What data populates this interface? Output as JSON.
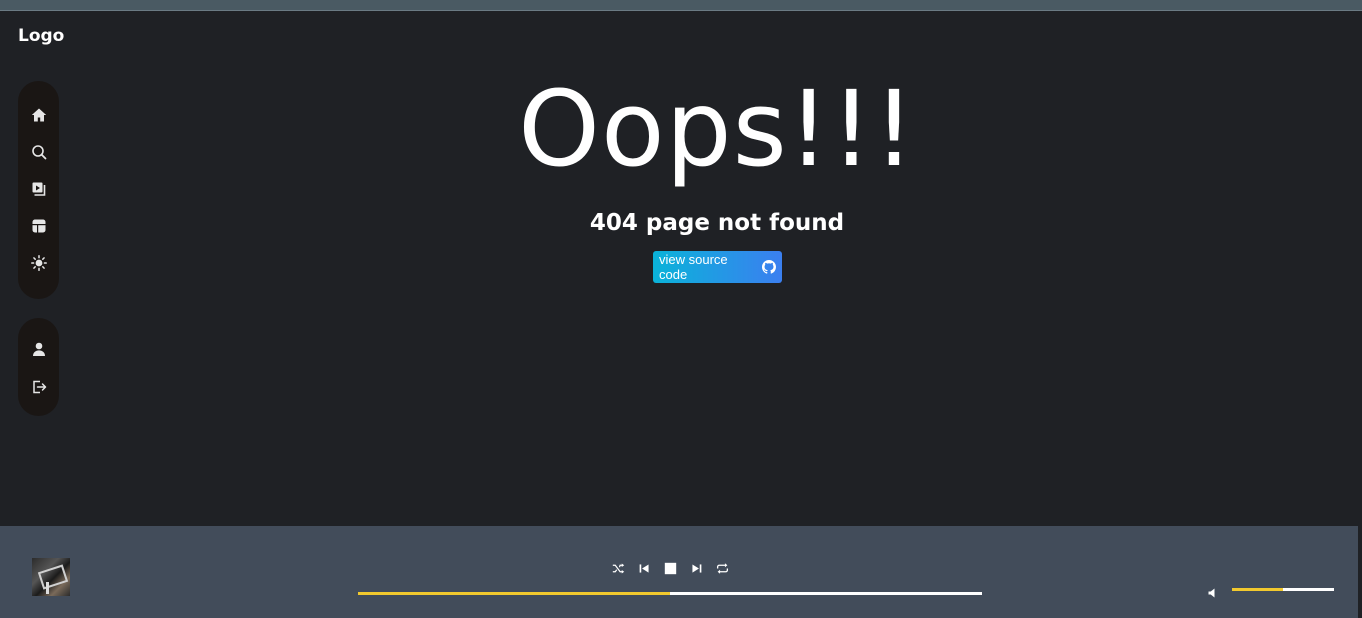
{
  "header": {
    "logo": "Logo"
  },
  "sidebar": {
    "top_items": [
      {
        "icon": "home-icon"
      },
      {
        "icon": "search-icon"
      },
      {
        "icon": "library-icon"
      },
      {
        "icon": "layout-icon"
      },
      {
        "icon": "sun-icon"
      }
    ],
    "bottom_items": [
      {
        "icon": "user-icon"
      },
      {
        "icon": "logout-icon"
      }
    ]
  },
  "error": {
    "title": "Oops!!!",
    "message": "404 page not found",
    "button_label": "view source code",
    "button_icon": "github-icon"
  },
  "player": {
    "controls": [
      "shuffle-icon",
      "previous-icon",
      "stop-icon",
      "next-icon",
      "repeat-icon"
    ],
    "progress": 0.5,
    "volume": 0.5
  },
  "colors": {
    "background": "#1f2125",
    "sidebar": "#1a1614",
    "player": "#424c5a",
    "accent": "#f2c92e",
    "button_gradient_start": "#0ab3d9",
    "button_gradient_end": "#3b7ff0"
  }
}
